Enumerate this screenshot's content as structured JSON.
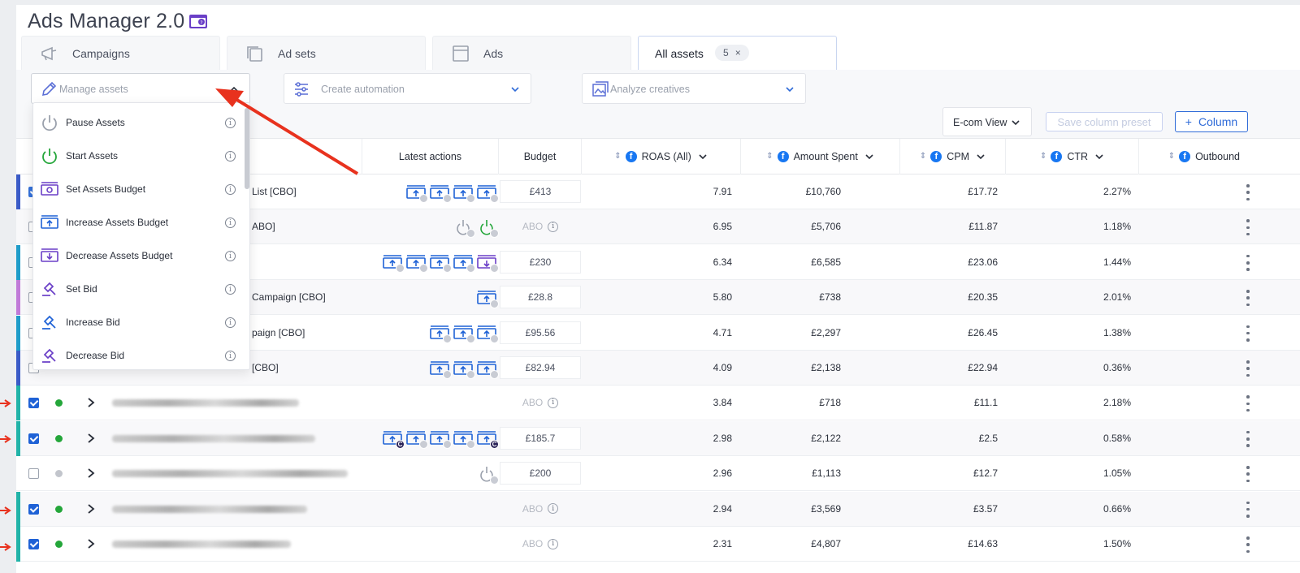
{
  "app": {
    "title": "Ads Manager 2.0"
  },
  "tabs": [
    {
      "label": "Campaigns"
    },
    {
      "label": "Ad sets"
    },
    {
      "label": "Ads"
    },
    {
      "label": "All assets",
      "count": "5",
      "close": "×"
    }
  ],
  "toolbar": {
    "manage_assets": "Manage assets",
    "create_automation": "Create automation",
    "analyze_creatives": "Analyze creatives",
    "view": "E-com View",
    "save_preset": "Save column preset",
    "column": "Column",
    "column_plus": "+"
  },
  "menu": {
    "items": [
      {
        "label": "Pause Assets",
        "icon": "power-icon"
      },
      {
        "label": "Start Assets",
        "icon": "power-on-icon"
      },
      {
        "label": "Set Assets Budget",
        "icon": "budget-set-icon"
      },
      {
        "label": "Increase Assets Budget",
        "icon": "budget-increase-icon"
      },
      {
        "label": "Decrease Assets Budget",
        "icon": "budget-decrease-icon"
      },
      {
        "label": "Set Bid",
        "icon": "gavel-icon"
      },
      {
        "label": "Increase Bid",
        "icon": "gavel-up-icon"
      },
      {
        "label": "Decrease Bid",
        "icon": "gavel-down-icon"
      }
    ],
    "info": "i"
  },
  "columns": {
    "latest_actions": "Latest actions",
    "budget": "Budget",
    "roas": "ROAS (All)",
    "amount_spent": "Amount Spent",
    "cpm": "CPM",
    "ctr": "CTR",
    "outbound": "Outbound"
  },
  "rows": [
    {
      "name": "List [CBO]",
      "checked": null,
      "status": null,
      "bar": "#3a5bc7",
      "actions": [
        "up",
        "up",
        "up",
        "up"
      ],
      "budget": "£413",
      "roas": "7.91",
      "spent": "£10,760",
      "cpm": "£17.72",
      "ctr": "2.27%"
    },
    {
      "name": "ABO]",
      "checked": false,
      "status": null,
      "bar": null,
      "actions": [
        "pause",
        "start"
      ],
      "budget": "ABO",
      "roas": "6.95",
      "spent": "£5,706",
      "cpm": "£11.87",
      "ctr": "1.18%"
    },
    {
      "name": "",
      "checked": false,
      "status": null,
      "bar": "#1e9cc9",
      "actions": [
        "up",
        "up",
        "up",
        "up",
        "down"
      ],
      "budget": "£230",
      "roas": "6.34",
      "spent": "£6,585",
      "cpm": "£23.06",
      "ctr": "1.44%"
    },
    {
      "name": "Campaign [CBO]",
      "checked": false,
      "status": null,
      "bar": "#c07ad8",
      "actions": [
        "up"
      ],
      "budget": "£28.8",
      "roas": "5.80",
      "spent": "£738",
      "cpm": "£20.35",
      "ctr": "2.01%"
    },
    {
      "name": "paign [CBO]",
      "checked": false,
      "status": null,
      "bar": "#1e9cc9",
      "actions": [
        "up",
        "up",
        "up"
      ],
      "budget": "£95.56",
      "roas": "4.71",
      "spent": "£2,297",
      "cpm": "£26.45",
      "ctr": "1.38%"
    },
    {
      "name": "[CBO]",
      "checked": false,
      "status": null,
      "bar": "#3a5bc7",
      "actions": [
        "up",
        "up",
        "up"
      ],
      "budget": "£82.94",
      "roas": "4.09",
      "spent": "£2,138",
      "cpm": "£22.94",
      "ctr": "0.36%"
    },
    {
      "name": "",
      "checked": true,
      "status": "#24a63a",
      "bar": "#21b3a8",
      "actions": [],
      "budget": "ABO",
      "roas": "3.84",
      "spent": "£718",
      "cpm": "£11.1",
      "ctr": "2.18%"
    },
    {
      "name": "",
      "checked": true,
      "status": "#24a63a",
      "bar": "#21b3a8",
      "actions": [
        "upc",
        "up",
        "up",
        "up",
        "upc"
      ],
      "budget": "£185.7",
      "roas": "2.98",
      "spent": "£2,122",
      "cpm": "£2.5",
      "ctr": "0.58%"
    },
    {
      "name": "",
      "checked": false,
      "status": "#c2c5cc",
      "bar": null,
      "actions": [
        "pause"
      ],
      "budget": "£200",
      "roas": "2.96",
      "spent": "£1,113",
      "cpm": "£12.7",
      "ctr": "1.05%"
    },
    {
      "name": "",
      "checked": true,
      "status": "#24a63a",
      "bar": "#21b3a8",
      "actions": [],
      "budget": "ABO",
      "roas": "2.94",
      "spent": "£3,569",
      "cpm": "£3.57",
      "ctr": "0.66%"
    },
    {
      "name": "",
      "checked": true,
      "status": "#24a63a",
      "bar": "#21b3a8",
      "actions": [],
      "budget": "ABO",
      "roas": "2.31",
      "spent": "£4,807",
      "cpm": "£14.63",
      "ctr": "1.50%"
    }
  ],
  "colors": {
    "accent": "#2f6bd8",
    "annotation_arrow": "#e8321e",
    "action_icon": "#1f62d6",
    "purple": "#6a3fc7"
  }
}
